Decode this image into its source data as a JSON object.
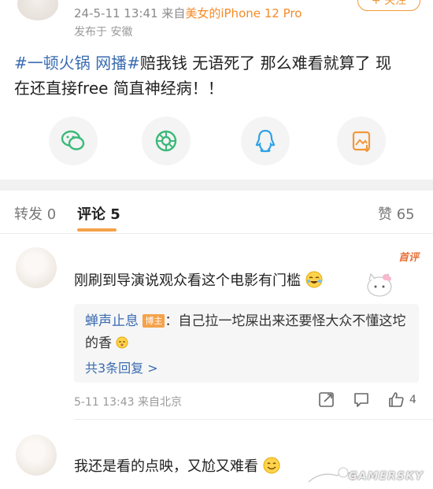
{
  "post": {
    "meta_time": "24-5-11 13:41",
    "meta_src_prefix": "来自",
    "meta_src": "美女的iPhone 12 Pro",
    "location": "发布于 安徽",
    "follow_label": "+ 关注",
    "tag1": "#一顿火锅 网播#",
    "body_line1": "赔我钱 无语死了 那么难看就算了 现",
    "body_line2": "在还直接free 简直神经病！！"
  },
  "share": {
    "icons": [
      "wechat-icon",
      "moments-icon",
      "qq-icon",
      "save-image-icon"
    ]
  },
  "tabs": {
    "repost": "转发 0",
    "comments": "评论 5",
    "likes": "赞 65"
  },
  "comments": [
    {
      "badge": "首评",
      "text": "刚刷到导演说观众看这个电影有门槛",
      "reply": {
        "name": "蝉声止息",
        "host_badge": "博主",
        "text": "：自己拉一坨屎出来还要怪大众不懂这坨的香",
        "more": "共3条回复 >"
      },
      "footer": "5-11 13:43  来自北京",
      "like_count": "4"
    },
    {
      "text": "我还是看的点映，又尬又难看"
    }
  ],
  "watermark": "GAMERSKY"
}
